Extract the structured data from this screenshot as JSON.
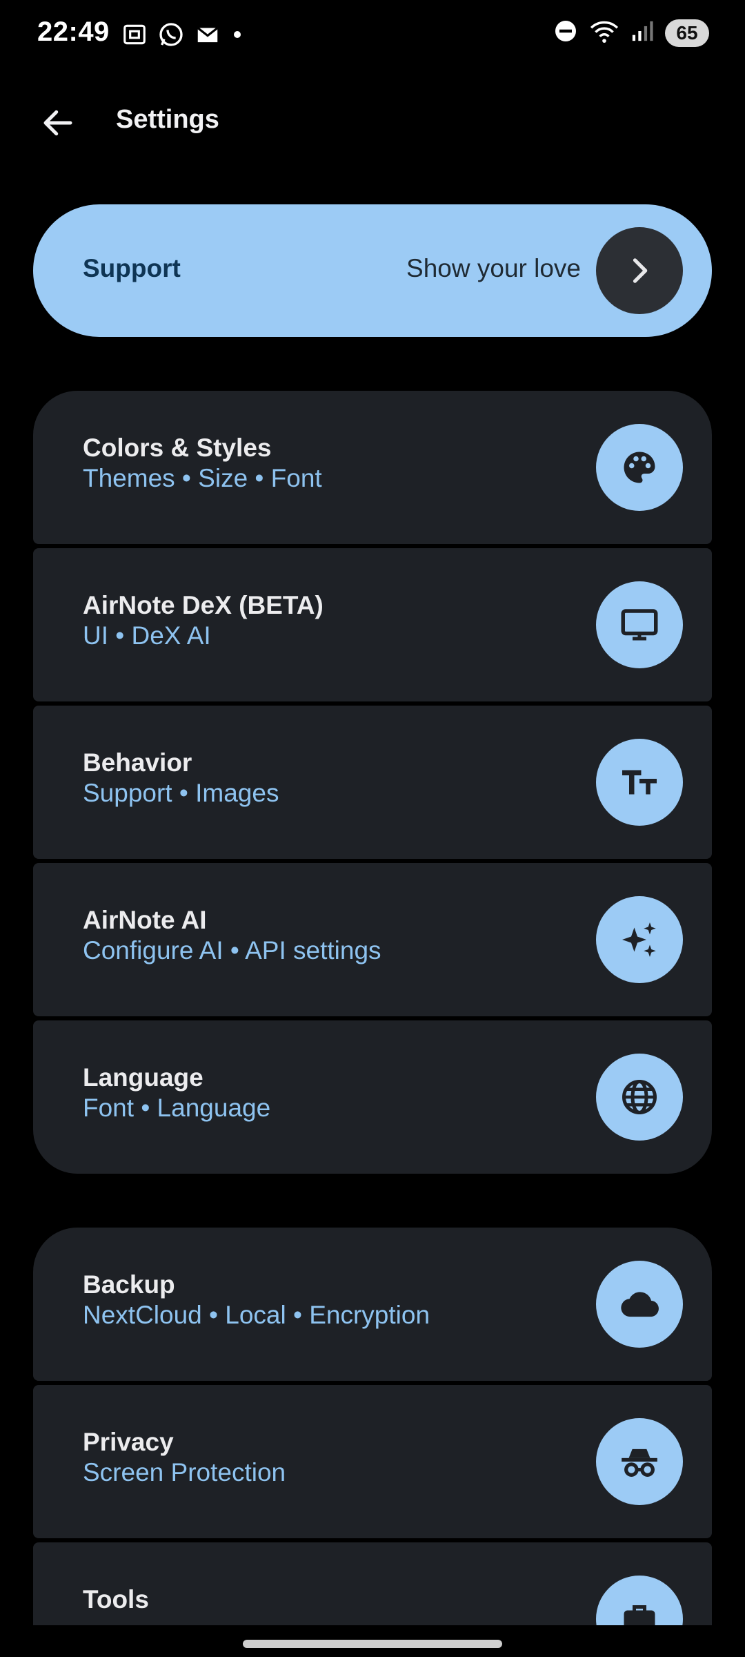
{
  "status_bar": {
    "time": "22:49",
    "notification_icons": [
      "screenshot-icon",
      "whatsapp-icon",
      "gmail-icon",
      "dot-icon"
    ],
    "system_icons": [
      "dnd-icon",
      "wifi-icon",
      "signal-icon"
    ],
    "battery": "65"
  },
  "appbar": {
    "title": "Settings"
  },
  "support": {
    "label": "Support",
    "subtitle": "Show your love"
  },
  "groups": [
    {
      "items": [
        {
          "title": "Colors & Styles",
          "subtitle": "Themes • Size • Font",
          "icon": "palette-icon"
        },
        {
          "title": "AirNote DeX (BETA)",
          "subtitle": "UI • DeX AI",
          "icon": "monitor-icon"
        },
        {
          "title": "Behavior",
          "subtitle": "Support • Images",
          "icon": "text-size-icon"
        },
        {
          "title": "AirNote AI",
          "subtitle": "Configure AI • API settings",
          "icon": "sparkle-icon"
        },
        {
          "title": "Language",
          "subtitle": "Font • Language",
          "icon": "globe-icon"
        }
      ]
    },
    {
      "items": [
        {
          "title": "Backup",
          "subtitle": "NextCloud • Local • Encryption",
          "icon": "cloud-icon"
        },
        {
          "title": "Privacy",
          "subtitle": "Screen Protection",
          "icon": "incognito-icon"
        },
        {
          "title": "Tools",
          "subtitle": "",
          "icon": "briefcase-icon"
        }
      ]
    }
  ],
  "colors": {
    "background": "#000000",
    "card": "#1e2126",
    "accent": "#9ccbf5",
    "subtitle": "#8ec3f0",
    "title": "#ececee"
  }
}
